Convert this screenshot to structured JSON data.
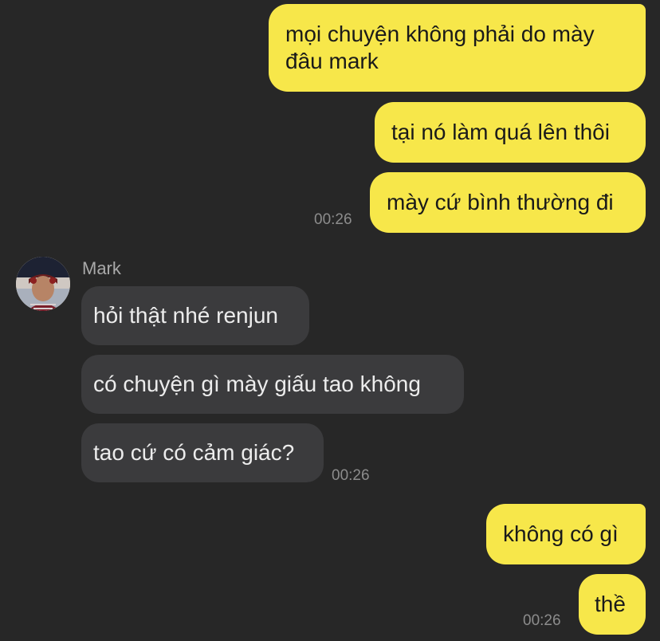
{
  "messages": {
    "out1": "mọi chuyện không phải do mày",
    "out1_line2": "đâu mark",
    "out2": "tại nó làm quá lên thôi",
    "out3": "mày cứ bình thường đi",
    "out3_time": "00:26",
    "sender_name": "Mark",
    "in1": "hỏi thật nhé renjun",
    "in2": "có chuyện gì mày giấu tao không",
    "in3": "tao cứ có cảm giác?",
    "in3_time": "00:26",
    "out4": "không có gì",
    "out5": "thề",
    "out5_time": "00:26"
  },
  "colors": {
    "background": "#272727",
    "outgoing_bubble": "#f7e74a",
    "incoming_bubble": "#3b3b3d"
  }
}
